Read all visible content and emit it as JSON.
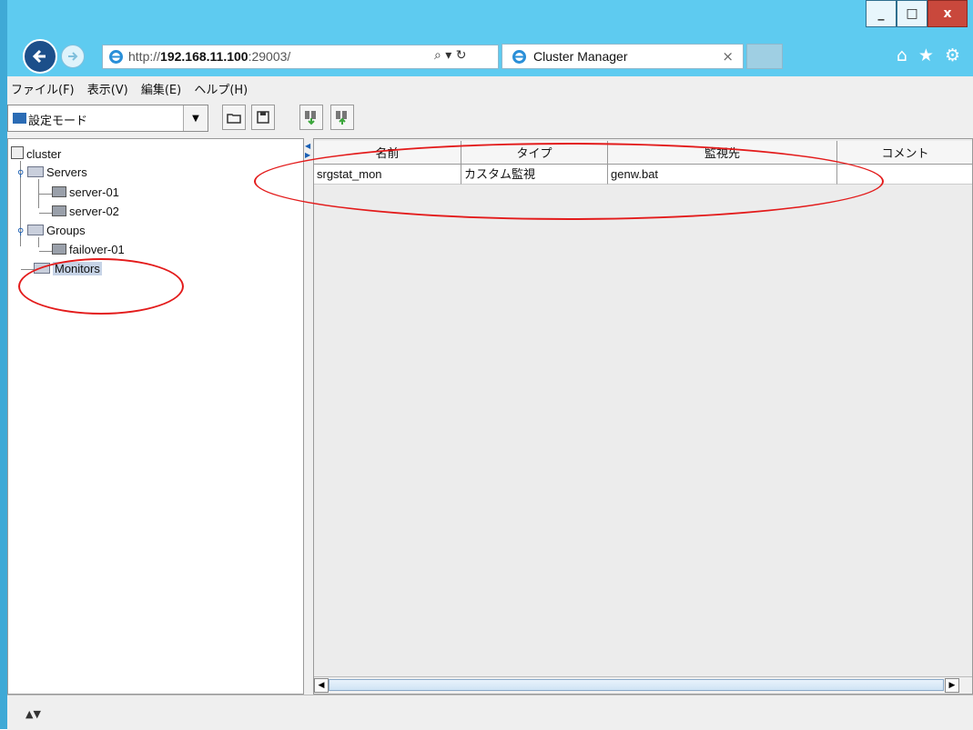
{
  "window": {
    "minimize_label": "_",
    "maximize_label": "□",
    "close_label": "x"
  },
  "browser": {
    "url_scheme": "http://",
    "url_host": "192.168.11.100",
    "url_rest": ":29003/",
    "search_refresh_label": "⌕ ▾ ↻",
    "tab_title": "Cluster Manager",
    "tab_close_label": "×",
    "nav_icons": [
      "home-icon",
      "star-icon",
      "gear-icon"
    ]
  },
  "menu": {
    "items": [
      "ファイル(F)",
      "表示(V)",
      "編集(E)",
      "ヘルプ(H)"
    ]
  },
  "toolbar": {
    "mode_label": "設定モード",
    "icons": [
      "open-icon",
      "save-icon",
      "download-cluster-icon",
      "upload-cluster-icon"
    ]
  },
  "tree": {
    "root": "cluster",
    "servers": "Servers",
    "server1": "server-01",
    "server2": "server-02",
    "groups": "Groups",
    "group1": "failover-01",
    "monitors": "Monitors"
  },
  "table": {
    "columns": [
      "名前",
      "タイプ",
      "監視先",
      "コメント"
    ],
    "rows": [
      [
        "srgstat_mon",
        "カスタム監視",
        "genw.bat",
        ""
      ]
    ]
  },
  "annotation_color": "#e31b1b",
  "accent_color": "#5ecbf0"
}
